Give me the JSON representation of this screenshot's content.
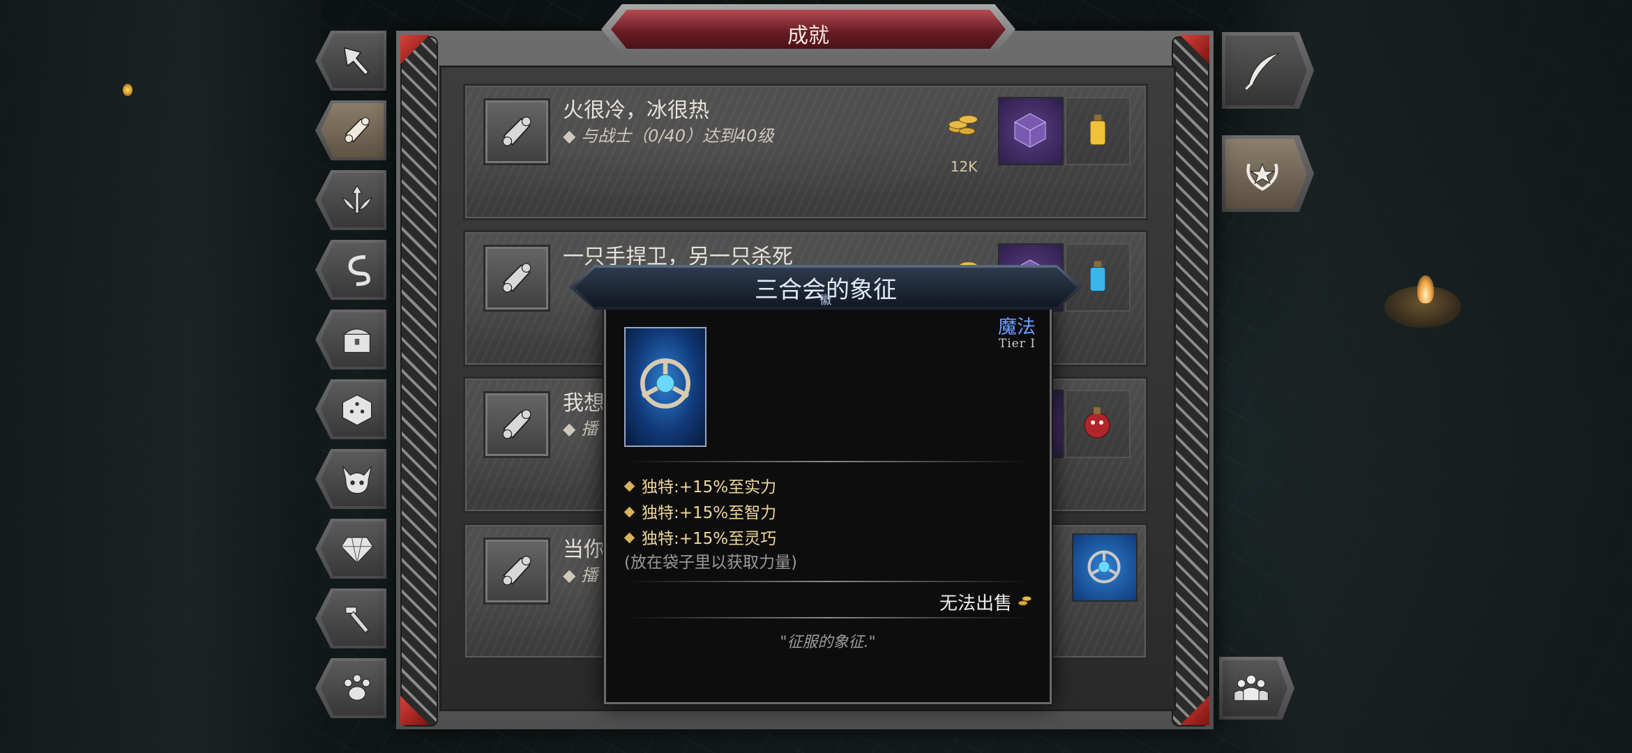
{
  "window": {
    "title": "成就"
  },
  "nav": {
    "items": [
      {
        "icon": "sword-banner-icon"
      },
      {
        "icon": "scroll-icon",
        "active": true
      },
      {
        "icon": "winged-arrow-icon"
      },
      {
        "icon": "serpent-icon"
      },
      {
        "icon": "treasure-chest-icon"
      },
      {
        "icon": "dice-icon"
      },
      {
        "icon": "demon-skull-icon"
      },
      {
        "icon": "gem-icon"
      },
      {
        "icon": "hammer-icon"
      },
      {
        "icon": "paw-icon"
      }
    ],
    "right_items": [
      {
        "icon": "quill-icon"
      },
      {
        "icon": "laurel-star-icon",
        "active": true
      },
      {
        "icon": "group-icon"
      }
    ]
  },
  "achievements": [
    {
      "title": "火很冷，冰很热",
      "requirement": "与战士（0/40）达到40级",
      "gold": "12K",
      "rewards": [
        "gold-coins-icon",
        "purple-cube-icon",
        "yellow-potion-icon"
      ]
    },
    {
      "title": "一只手捍卫，另一只杀死",
      "requirement": "",
      "rewards": [
        "gold-coins-icon",
        "purple-cube-icon",
        "blue-potion-icon"
      ]
    },
    {
      "title": "我想",
      "requirement": "播",
      "rewards": [
        "purple-cube-icon",
        "red-skull-flask-icon"
      ]
    },
    {
      "title": "当你",
      "requirement": "播",
      "rewards": [
        "triad-sigil-icon"
      ]
    }
  ],
  "tooltip": {
    "name": "三合会的象征",
    "type": "徽",
    "category": "魔法",
    "tier": "Tier I",
    "stats": [
      "独特:+15%至实力",
      "独特:+15%至智力",
      "独特:+15%至灵巧"
    ],
    "note": "(放在袋子里以获取力量)",
    "sell": "无法出售",
    "quote": "\"征服的象征.\"",
    "colors": {
      "category": "#6f9cff",
      "stat": "#f0d89a"
    }
  }
}
